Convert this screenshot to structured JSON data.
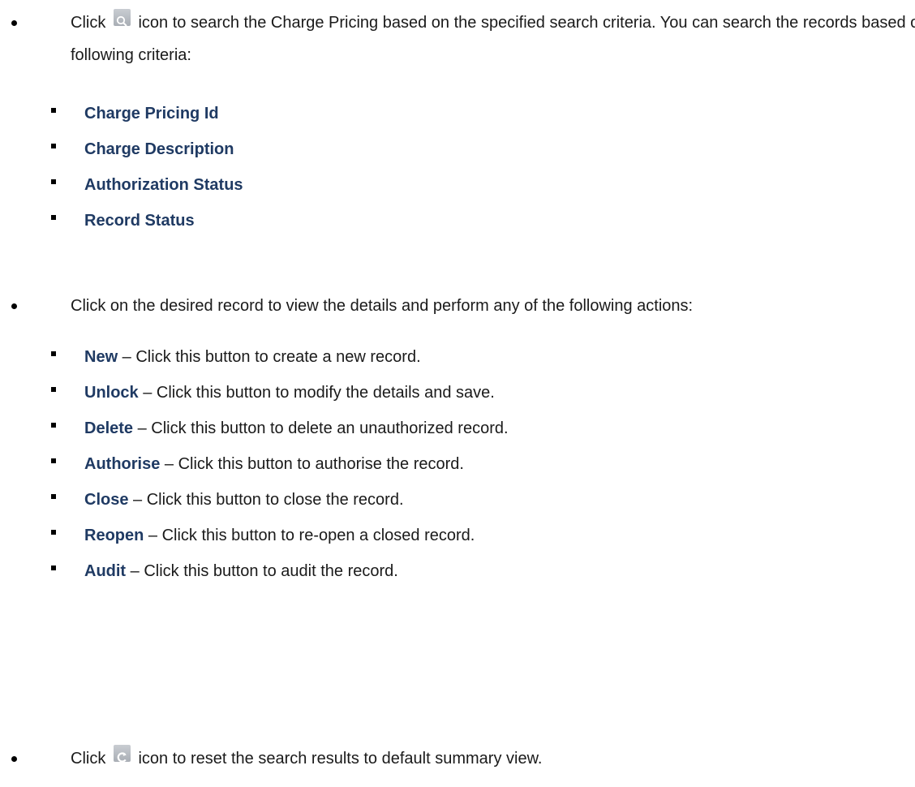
{
  "bullets": [
    {
      "before_icon": "Click",
      "icon": "search-icon",
      "text": "icon to search the Charge Pricing based on the specified search criteria. You can search the records based on the following criteria:",
      "items": [
        {
          "bold": "Charge Pricing Id"
        },
        {
          "bold": "Charge Description"
        },
        {
          "bold": "Authorization Status"
        },
        {
          "bold": "Record Status"
        }
      ]
    },
    {
      "text": "Click on the desired record to view the details and perform any of the following actions:",
      "items": [
        {
          "bold": "New",
          "rest": " – Click this button to create a new record."
        },
        {
          "bold": "Unlock",
          "rest": " – Click this button to modify the details and save."
        },
        {
          "bold": "Delete",
          "rest": " – Click this button to delete an unauthorized record."
        },
        {
          "bold": "Authorise",
          "rest": " – Click this button to authorise the record."
        },
        {
          "bold": "Close",
          "rest": " – Click this button to close the record."
        },
        {
          "bold": "Reopen",
          "rest": " – Click this button to re-open a closed record."
        },
        {
          "bold": "Audit",
          "rest": " – Click this button to audit the record."
        }
      ]
    },
    {
      "before_icon": "Click",
      "icon": "refresh-icon",
      "text": "icon to reset the search results to default summary view."
    }
  ]
}
